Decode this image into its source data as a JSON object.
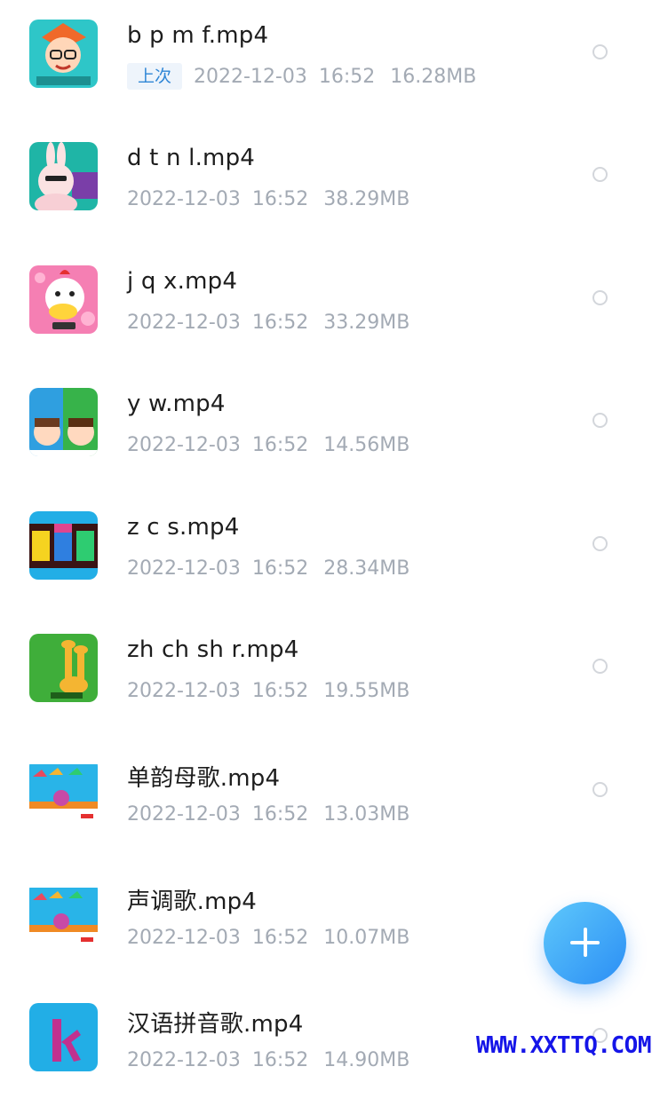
{
  "files": [
    {
      "name": "b p m f.mp4",
      "badge": "上次",
      "date": "2022-12-03",
      "time": "16:52",
      "size": "16.28MB",
      "thumb_icon": "cartoon-boy-thumbnail"
    },
    {
      "name": "d t n l.mp4",
      "date": "2022-12-03",
      "time": "16:52",
      "size": "38.29MB",
      "thumb_icon": "bunny-thumbnail"
    },
    {
      "name": "j q x.mp4",
      "date": "2022-12-03",
      "time": "16:52",
      "size": "33.29MB",
      "thumb_icon": "chicken-thumbnail"
    },
    {
      "name": "y w.mp4",
      "date": "2022-12-03",
      "time": "16:52",
      "size": "14.56MB",
      "thumb_icon": "kids-thumbnail"
    },
    {
      "name": "z c s.mp4",
      "date": "2022-12-03",
      "time": "16:52",
      "size": "28.34MB",
      "thumb_icon": "letters-zcs-thumbnail"
    },
    {
      "name": "zh ch sh r.mp4",
      "date": "2022-12-03",
      "time": "16:52",
      "size": "19.55MB",
      "thumb_icon": "giraffe-thumbnail"
    },
    {
      "name": "单韵母歌.mp4",
      "date": "2022-12-03",
      "time": "16:52",
      "size": "13.03MB",
      "thumb_icon": "stage-thumbnail"
    },
    {
      "name": "声调歌.mp4",
      "date": "2022-12-03",
      "time": "16:52",
      "size": "10.07MB",
      "thumb_icon": "stage-thumbnail"
    },
    {
      "name": "汉语拼音歌.mp4",
      "date": "2022-12-03",
      "time": "16:52",
      "size": "14.90MB",
      "thumb_icon": "letter-k-thumbnail"
    }
  ],
  "fab": {
    "icon": "plus-icon",
    "color": "#2b8ef5"
  },
  "watermark": "WWW.XXTTQ.COM"
}
